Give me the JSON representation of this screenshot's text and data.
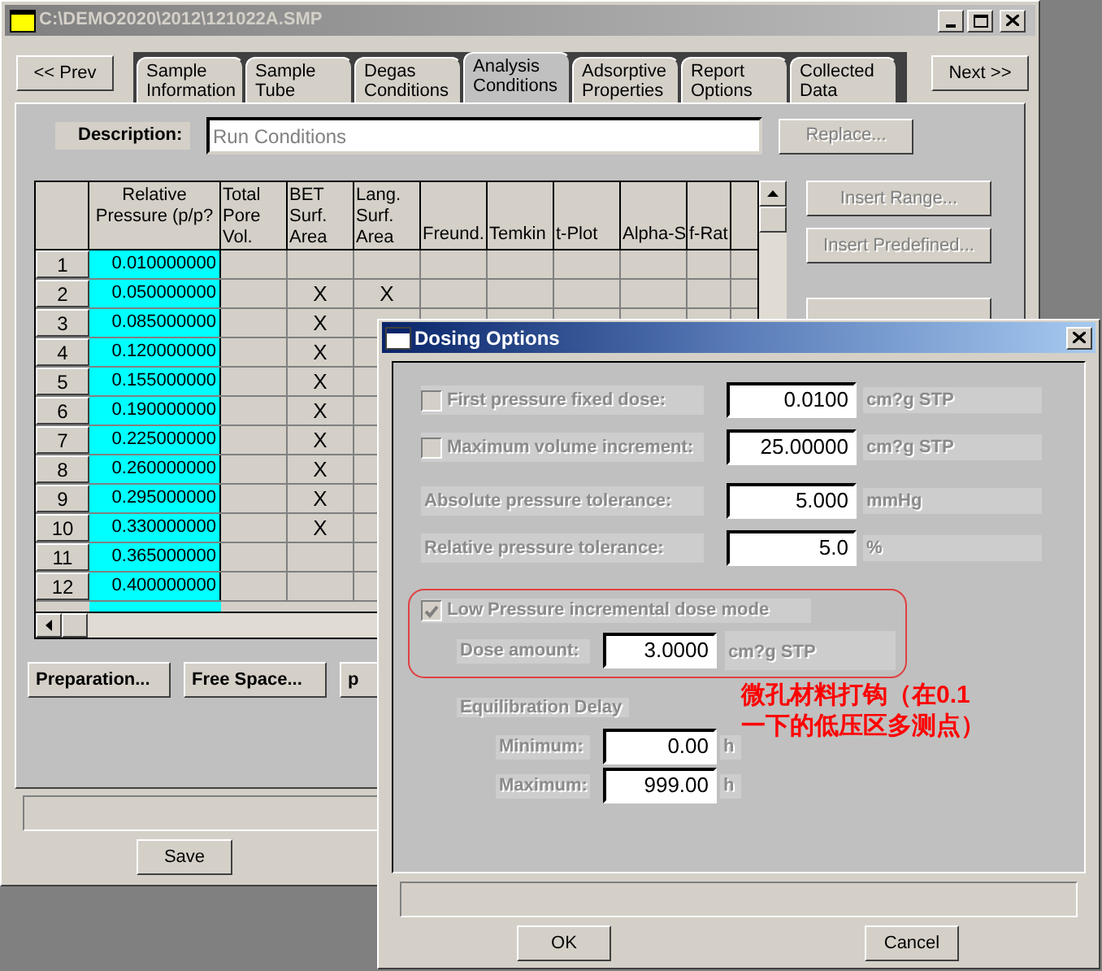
{
  "main_window": {
    "title": "C:\\DEMO2020\\2012\\121022A.SMP",
    "prev_button": "<< Prev",
    "next_button": "Next >>",
    "tabs": [
      {
        "label": "Sample Information",
        "selected": false
      },
      {
        "label": "Sample Tube",
        "selected": false
      },
      {
        "label": "Degas Conditions",
        "selected": false
      },
      {
        "label": "Analysis Conditions",
        "selected": true
      },
      {
        "label": "Adsorptive Properties",
        "selected": false
      },
      {
        "label": "Report Options",
        "selected": false
      },
      {
        "label": "Collected Data",
        "selected": false
      }
    ],
    "description": {
      "label": "Description:",
      "placeholder": "Run Conditions"
    },
    "replace_button": {
      "label": "Replace...",
      "disabled": true
    },
    "table": {
      "columns": [
        "Relative Pressure (p/p?",
        "Total Pore Vol.",
        "BET Surf. Area",
        "Lang. Surf. Area",
        "Freund.",
        "Temkin",
        "t-Plot",
        "Alpha-S",
        "f-Rat"
      ],
      "rows": [
        {
          "index": "1",
          "pressure": "0.010000000"
        },
        {
          "index": "2",
          "pressure": "0.050000000",
          "bet": "X",
          "lang": "X"
        },
        {
          "index": "3",
          "pressure": "0.085000000",
          "bet": "X"
        },
        {
          "index": "4",
          "pressure": "0.120000000",
          "bet": "X"
        },
        {
          "index": "5",
          "pressure": "0.155000000",
          "bet": "X"
        },
        {
          "index": "6",
          "pressure": "0.190000000",
          "bet": "X"
        },
        {
          "index": "7",
          "pressure": "0.225000000",
          "bet": "X"
        },
        {
          "index": "8",
          "pressure": "0.260000000",
          "bet": "X"
        },
        {
          "index": "9",
          "pressure": "0.295000000",
          "bet": "X"
        },
        {
          "index": "10",
          "pressure": "0.330000000",
          "bet": "X"
        },
        {
          "index": "11",
          "pressure": "0.365000000"
        },
        {
          "index": "12",
          "pressure": "0.400000000"
        }
      ]
    },
    "side_buttons": [
      {
        "label": "Insert Range...",
        "disabled": true
      },
      {
        "label": "Insert Predefined...",
        "disabled": true
      }
    ],
    "bottom_buttons": [
      {
        "label": "Preparation..."
      },
      {
        "label": "Free Space..."
      },
      {
        "label": "p"
      }
    ],
    "save_button": "Save"
  },
  "dialog": {
    "title": "Dosing Options",
    "options": [
      {
        "kind": "checkbox",
        "label": "First pressure fixed dose:",
        "checked": false,
        "value": "0.0100",
        "unit": "cm?g STP"
      },
      {
        "kind": "checkbox",
        "label": "Maximum volume increment:",
        "checked": false,
        "value": "25.00000",
        "unit": "cm?g STP"
      },
      {
        "kind": "field",
        "label": "Absolute pressure tolerance:",
        "value": "5.000",
        "unit": "mmHg"
      },
      {
        "kind": "field",
        "label": "Relative pressure tolerance:",
        "value": "5.0",
        "unit": "%"
      }
    ],
    "low_pressure": {
      "label": "Low Pressure incremental dose mode",
      "checked": true,
      "dose_label": "Dose amount:",
      "dose_value": "3.0000",
      "dose_unit": "cm?g STP"
    },
    "equilibration": {
      "heading": "Equilibration Delay",
      "fields": [
        {
          "label": "Minimum:",
          "value": "0.00",
          "unit": "h"
        },
        {
          "label": "Maximum:",
          "value": "999.00",
          "unit": "h"
        }
      ]
    },
    "annotation": "微孔材料打钩（在0.1一下的低压区多测点）",
    "ok_button": "OK",
    "cancel_button": "Cancel"
  }
}
